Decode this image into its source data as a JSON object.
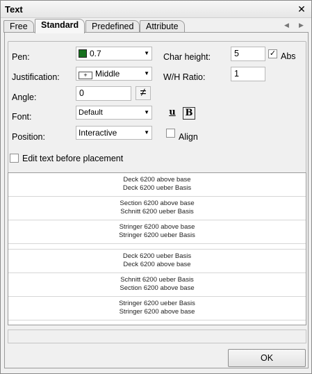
{
  "window": {
    "title": "Text",
    "close_glyph": "✕"
  },
  "tabs": [
    {
      "label": "Free",
      "active": false
    },
    {
      "label": "Standard",
      "active": true
    },
    {
      "label": "Predefined",
      "active": false
    },
    {
      "label": "Attribute",
      "active": false
    }
  ],
  "form": {
    "pen_label": "Pen:",
    "pen_value": "0.7",
    "pen_color": "#17711e",
    "justification_label": "Justification:",
    "justification_value": "Middle",
    "angle_label": "Angle:",
    "angle_value": "0",
    "font_label": "Font:",
    "font_value": "Default",
    "position_label": "Position:",
    "position_value": "Interactive",
    "char_height_label": "Char height:",
    "char_height_value": "5",
    "abs_label": "Abs",
    "abs_checked": true,
    "wh_ratio_label": "W/H Ratio:",
    "wh_ratio_value": "1",
    "underline_glyph": "u",
    "bold_glyph": "B",
    "align_label": "Align",
    "align_checked": false
  },
  "edit_before_placement": {
    "label": "Edit text before placement",
    "checked": false
  },
  "text_list": [
    {
      "line1": "Deck 6200 above base",
      "line2": "Deck 6200 ueber Basis"
    },
    {
      "line1": "Section 6200 above base",
      "line2": "Schnitt 6200 ueber Basis"
    },
    {
      "line1": "Stringer 6200 above base",
      "line2": "Stringer 6200 ueber Basis"
    },
    {
      "line1": "Deck 6200 ueber Basis",
      "line2": "Deck 6200 above base"
    },
    {
      "line1": "Schnitt 6200 ueber Basis",
      "line2": "Section 6200 above base"
    },
    {
      "line1": "Stringer 6200 ueber Basis",
      "line2": "Stringer 6200 above base"
    }
  ],
  "ok_label": "OK"
}
